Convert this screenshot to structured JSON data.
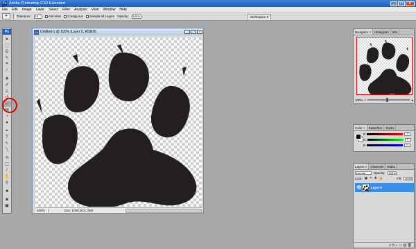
{
  "app": {
    "title": "Adobe Photoshop CS3 Extended",
    "icon_label": "Ps"
  },
  "window_buttons": {
    "minimize": "_",
    "maximize": "□",
    "close": "✕"
  },
  "menu": [
    "File",
    "Edit",
    "Image",
    "Layer",
    "Select",
    "Filter",
    "Analysis",
    "View",
    "Window",
    "Help"
  ],
  "options": {
    "tool_icon": "magic-wand-icon",
    "tolerance_label": "Tolerance:",
    "tolerance_value": "10",
    "antialias_label": "Anti-alias",
    "contiguous_label": "Contiguous",
    "sample_label": "Sample All Layers",
    "opacity_label": "Opacity:",
    "opacity_value": "100%",
    "workspace_label": "Workspace ▾"
  },
  "toolbox": {
    "logo": "Ps"
  },
  "document": {
    "title": "Untitled-1 @ 100% (Layer 0, RGB/8)",
    "zoom": "100%",
    "doc_info": "Doc: 1000.2K/1.33M"
  },
  "navigator": {
    "tabs": [
      "Navigator ×",
      "Histogram",
      "Info"
    ],
    "zoom": "100%"
  },
  "color_panel": {
    "tabs": [
      "Color ×",
      "Swatches",
      "Styles"
    ],
    "channels": [
      {
        "name": "R",
        "value": "0"
      },
      {
        "name": "G",
        "value": "0"
      },
      {
        "name": "B",
        "value": "0"
      }
    ]
  },
  "layers_panel": {
    "tabs": [
      "Layers ×",
      "Channels",
      "Paths"
    ],
    "blend_mode": "Normal",
    "opacity_label": "Opacity:",
    "opacity_value": "100%",
    "lock_label": "Lock:",
    "fill_label": "Fill:",
    "fill_value": "100%",
    "layer_name": "Layer 0",
    "foot_icons": "∞  fx  ◐  ▭  ▤  🗑"
  },
  "colors": {
    "titlebar": "#1f5fbf",
    "selection": "#3a8ee8",
    "highlight_circle": "#e00000",
    "paw": "#231f20"
  }
}
